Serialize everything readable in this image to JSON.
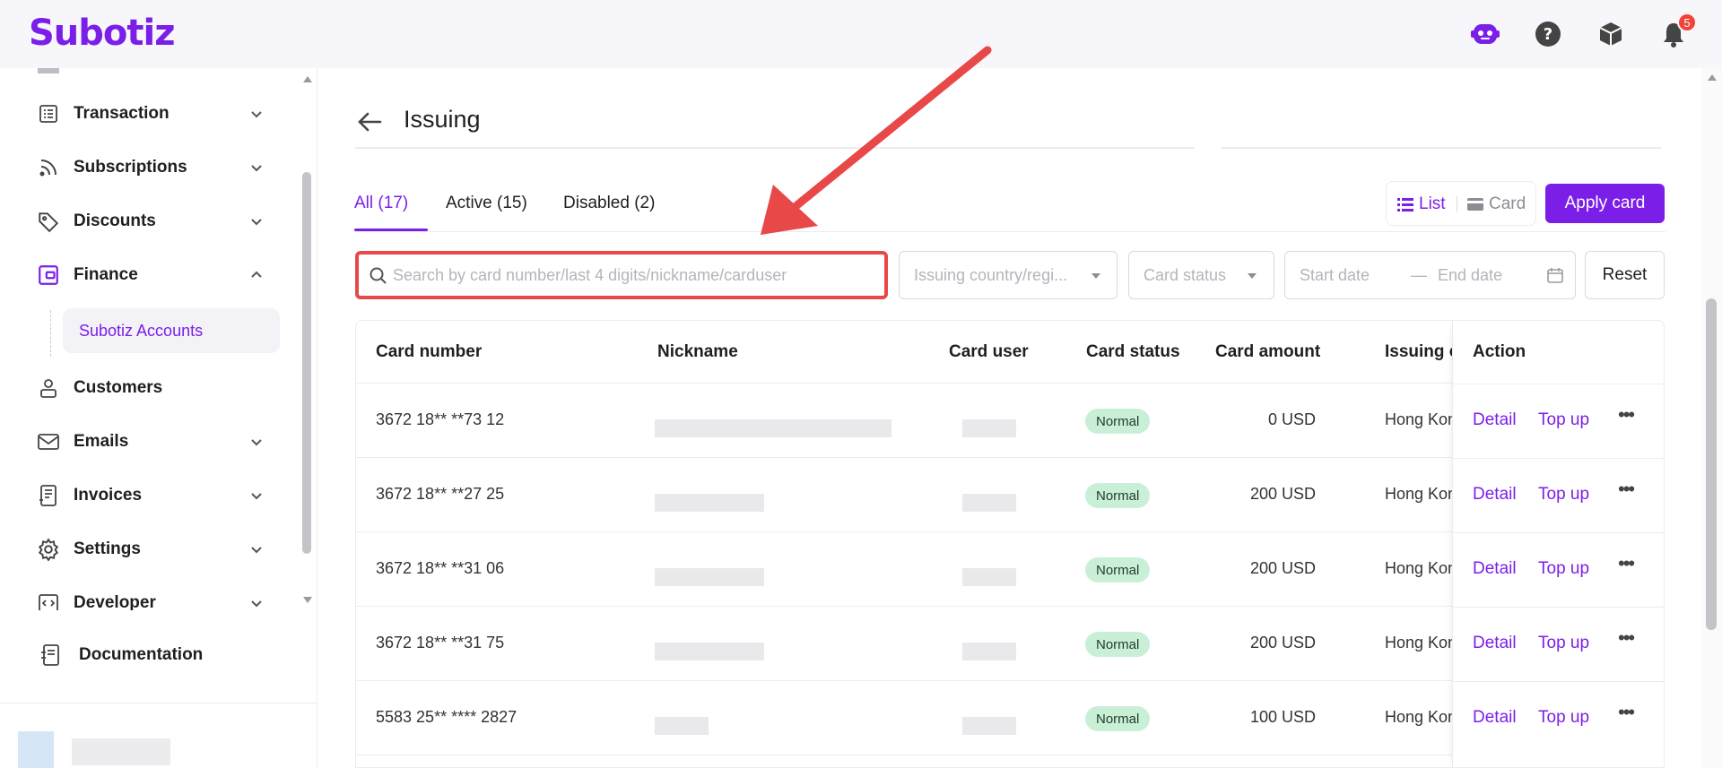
{
  "app": {
    "brand": "Subotiz",
    "notification_count": "5"
  },
  "sidebar": {
    "items": [
      {
        "label": "Transaction",
        "icon": "list-icon",
        "expandable": true
      },
      {
        "label": "Subscriptions",
        "icon": "rss-icon",
        "expandable": true
      },
      {
        "label": "Discounts",
        "icon": "tag-icon",
        "expandable": true
      },
      {
        "label": "Finance",
        "icon": "wallet-icon",
        "expandable": true,
        "expanded": true
      },
      {
        "label": "Customers",
        "icon": "user-icon",
        "expandable": false
      },
      {
        "label": "Emails",
        "icon": "mail-icon",
        "expandable": true
      },
      {
        "label": "Invoices",
        "icon": "receipt-icon",
        "expandable": true
      },
      {
        "label": "Settings",
        "icon": "gear-icon",
        "expandable": true
      },
      {
        "label": "Developer",
        "icon": "code-icon",
        "expandable": true
      },
      {
        "label": "Documentation",
        "icon": "doc-icon",
        "expandable": false
      }
    ],
    "finance_sub": {
      "label": "Subotiz Accounts"
    }
  },
  "page": {
    "title": "Issuing"
  },
  "tabs": [
    {
      "label": "All  (17)",
      "active": true
    },
    {
      "label": "Active  (15)",
      "active": false
    },
    {
      "label": "Disabled  (2)",
      "active": false
    }
  ],
  "view_toggle": {
    "list": "List",
    "card": "Card"
  },
  "apply_button": "Apply card",
  "filters": {
    "search_placeholder": "Search by card number/last 4 digits/nickname/carduser",
    "country_placeholder": "Issuing country/regi...",
    "status_placeholder": "Card status",
    "start_date": "Start date",
    "end_date": "End date",
    "date_separator": "—",
    "reset": "Reset"
  },
  "table": {
    "columns": [
      "Card number",
      "Nickname",
      "Card user",
      "Card status",
      "Card amount",
      "Issuing c",
      "Action"
    ],
    "rows": [
      {
        "card_number": "3672 18** **73 12",
        "status": "Normal",
        "amount": "0 USD",
        "country": "Hong Kon"
      },
      {
        "card_number": "3672 18** **27 25",
        "status": "Normal",
        "amount": "200 USD",
        "country": "Hong Kon"
      },
      {
        "card_number": "3672 18** **31 06",
        "status": "Normal",
        "amount": "200 USD",
        "country": "Hong Kon"
      },
      {
        "card_number": "3672 18** **31 75",
        "status": "Normal",
        "amount": "200 USD",
        "country": "Hong Kon"
      },
      {
        "card_number": "5583 25** **** 2827",
        "status": "Normal",
        "amount": "100 USD",
        "country": "Hong Kon"
      }
    ],
    "action_labels": {
      "detail": "Detail",
      "top_up": "Top up"
    }
  },
  "colors": {
    "brand": "#7b1fe8",
    "annotation": "#e84848",
    "status_bg": "#c9f0d7"
  }
}
